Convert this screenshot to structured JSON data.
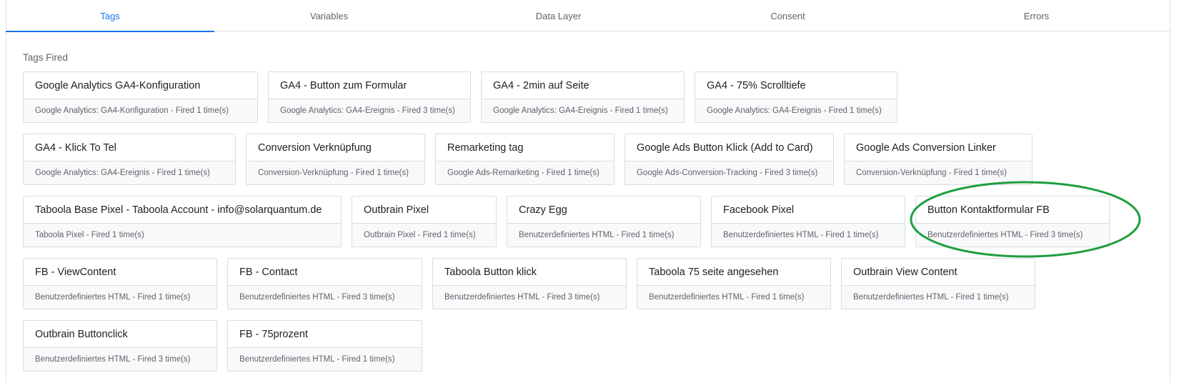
{
  "tabs": [
    {
      "label": "Tags",
      "active": true
    },
    {
      "label": "Variables",
      "active": false
    },
    {
      "label": "Data Layer",
      "active": false
    },
    {
      "label": "Consent",
      "active": false
    },
    {
      "label": "Errors",
      "active": false
    }
  ],
  "section_title": "Tags Fired",
  "rows": [
    [
      {
        "title": "Google Analytics GA4-Konfiguration",
        "sub": "Google Analytics: GA4-Konfiguration - Fired 1 time(s)"
      },
      {
        "title": "GA4 - Button zum Formular",
        "sub": "Google Analytics: GA4-Ereignis - Fired 3 time(s)"
      },
      {
        "title": "GA4 - 2min auf Seite",
        "sub": "Google Analytics: GA4-Ereignis - Fired 1 time(s)"
      },
      {
        "title": "GA4 - 75% Scrolltiefe",
        "sub": "Google Analytics: GA4-Ereignis - Fired 1 time(s)"
      }
    ],
    [
      {
        "title": "GA4 - Klick To Tel",
        "sub": "Google Analytics: GA4-Ereignis - Fired 1 time(s)"
      },
      {
        "title": "Conversion Verknüpfung",
        "sub": "Conversion-Verknüpfung - Fired 1 time(s)"
      },
      {
        "title": "Remarketing tag",
        "sub": "Google Ads-Remarketing - Fired 1 time(s)"
      },
      {
        "title": "Google Ads Button Klick (Add to Card)",
        "sub": "Google Ads-Conversion-Tracking - Fired 3 time(s)"
      },
      {
        "title": "Google Ads Conversion Linker",
        "sub": "Conversion-Verknüpfung - Fired 1 time(s)"
      }
    ],
    [
      {
        "title": "Taboola Base Pixel - Taboola Account - info@solarquantum.de",
        "sub": "Taboola Pixel - Fired 1 time(s)"
      },
      {
        "title": "Outbrain Pixel",
        "sub": "Outbrain Pixel - Fired 1 time(s)"
      },
      {
        "title": "Crazy Egg",
        "sub": "Benutzerdefiniertes HTML - Fired 1 time(s)"
      },
      {
        "title": "Facebook Pixel",
        "sub": "Benutzerdefiniertes HTML - Fired 1 time(s)"
      },
      {
        "title": "Button Kontaktformular FB",
        "sub": "Benutzerdefiniertes HTML - Fired 3 time(s)"
      }
    ],
    [
      {
        "title": "FB - ViewContent",
        "sub": "Benutzerdefiniertes HTML - Fired 1 time(s)"
      },
      {
        "title": "FB - Contact",
        "sub": "Benutzerdefiniertes HTML - Fired 3 time(s)"
      },
      {
        "title": "Taboola Button klick",
        "sub": "Benutzerdefiniertes HTML - Fired 3 time(s)"
      },
      {
        "title": "Taboola 75 seite angesehen",
        "sub": "Benutzerdefiniertes HTML - Fired 1 time(s)"
      },
      {
        "title": "Outbrain View Content",
        "sub": "Benutzerdefiniertes HTML - Fired 1 time(s)"
      }
    ],
    [
      {
        "title": "Outbrain Buttonclick",
        "sub": "Benutzerdefiniertes HTML - Fired 3 time(s)"
      },
      {
        "title": "FB - 75prozent",
        "sub": "Benutzerdefiniertes HTML - Fired 1 time(s)"
      }
    ]
  ],
  "colors": {
    "accent": "#1a73e8",
    "highlight_ring": "#1e9e3e"
  }
}
